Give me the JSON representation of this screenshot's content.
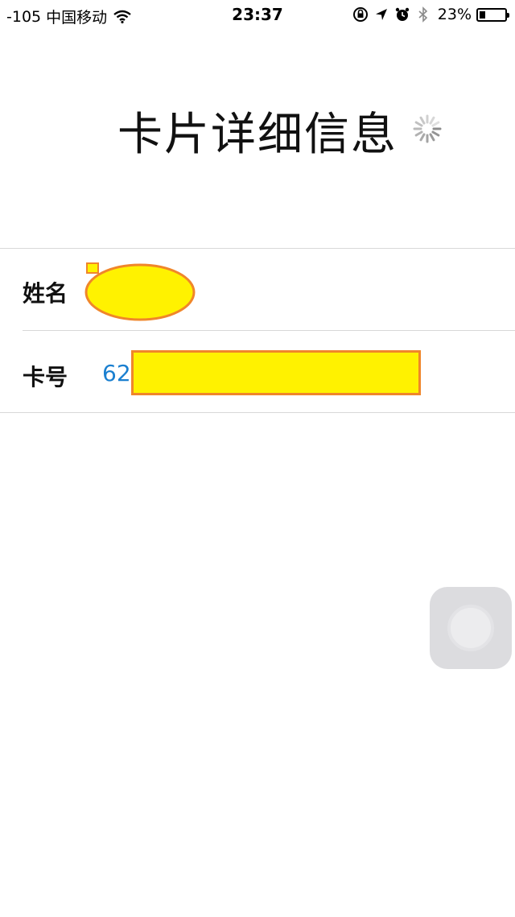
{
  "status_bar": {
    "signal": "-105",
    "carrier": "中国移动",
    "time": "23:37",
    "battery_percent": "23%",
    "battery_level": 0.23,
    "icons": [
      "wifi-icon",
      "orientation-lock-icon",
      "location-icon",
      "alarm-icon",
      "bluetooth-icon",
      "battery-icon"
    ]
  },
  "header": {
    "title": "卡片详细信息"
  },
  "details": {
    "rows": [
      {
        "label": "姓名",
        "value": ""
      },
      {
        "label": "卡号",
        "value": "62"
      }
    ]
  },
  "colors": {
    "link_value": "#1a7fd0",
    "redaction_fill": "#fff200",
    "redaction_border": "#f0862a"
  }
}
